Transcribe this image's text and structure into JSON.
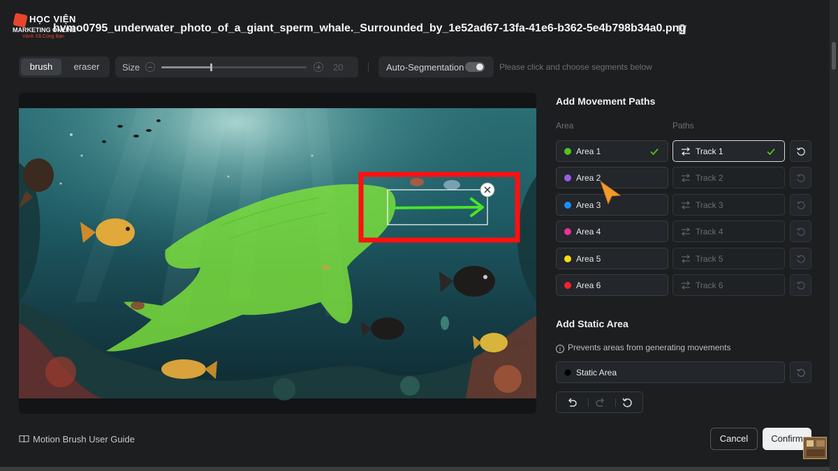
{
  "logo": {
    "line1": "HỌC VIỆN",
    "line2": "MARKETING ONLINE",
    "line3": "Vành Xã Cùng Bạn",
    "accent": "#e8452c"
  },
  "header": {
    "file_title": "hvmo0795_underwater_photo_of_a_giant_sperm_whale._Surrounded_by_1e52ad67-13fa-41e6-b362-5e4b798b34a0.png",
    "delete_icon": "trash-icon"
  },
  "toolbar": {
    "brush_label": "brush",
    "eraser_label": "eraser",
    "active_tool": "brush",
    "size_label": "Size",
    "size_value": "20",
    "size_fraction": 0.34,
    "autoseg_label": "Auto-Segmentation",
    "autoseg_on": true,
    "hint": "Please click and choose segments below"
  },
  "movement": {
    "title": "Add Movement Paths",
    "area_col": "Area",
    "paths_col": "Paths",
    "rows": [
      {
        "area": "Area 1",
        "color": "#52c41a",
        "area_done": true,
        "track": "Track 1",
        "track_active": true,
        "track_done": true
      },
      {
        "area": "Area 2",
        "color": "#9b5de5",
        "area_done": false,
        "track": "Track 2",
        "track_active": false,
        "track_done": false
      },
      {
        "area": "Area 3",
        "color": "#1890ff",
        "area_done": false,
        "track": "Track 3",
        "track_active": false,
        "track_done": false
      },
      {
        "area": "Area 4",
        "color": "#eb2f96",
        "area_done": false,
        "track": "Track 4",
        "track_active": false,
        "track_done": false
      },
      {
        "area": "Area 5",
        "color": "#fadb14",
        "area_done": false,
        "track": "Track 5",
        "track_active": false,
        "track_done": false
      },
      {
        "area": "Area 6",
        "color": "#f5222d",
        "area_done": false,
        "track": "Track 6",
        "track_active": false,
        "track_done": false
      }
    ]
  },
  "static": {
    "title": "Add Static Area",
    "info": "Prevents areas from generating movements",
    "area_label": "Static Area"
  },
  "footer": {
    "guide_label": "Motion Brush User Guide",
    "cancel_label": "Cancel",
    "confirm_label": "Confirm"
  },
  "colors": {
    "mask_green": "#7ee23a",
    "arrow_green": "#49e32b",
    "highlight_red": "#ff1010"
  }
}
